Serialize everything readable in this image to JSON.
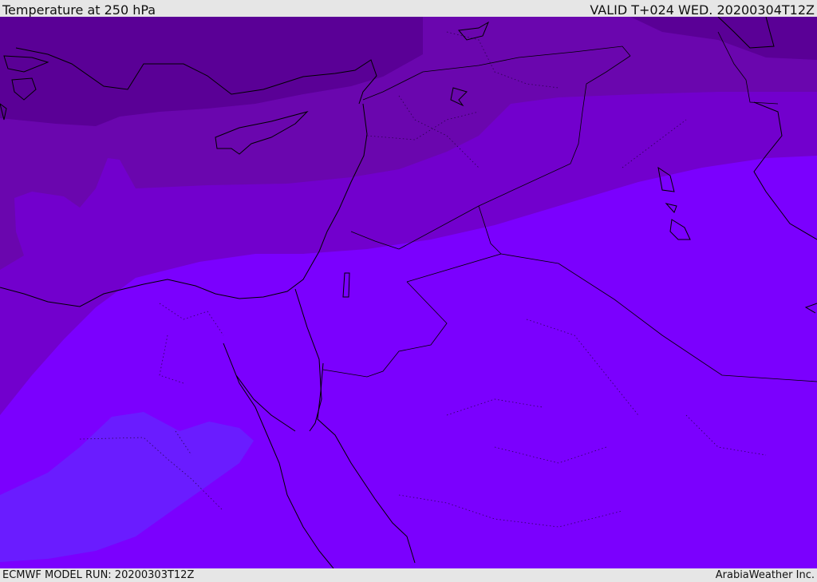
{
  "header": {
    "title": "Temperature at 250 hPa",
    "valid": "VALID T+024 WED. 20200304T12Z"
  },
  "footer": {
    "model_run": "ECMWF MODEL RUN: 20200303T12Z",
    "credit": "ArabiaWeather Inc."
  },
  "map": {
    "field": "temperature",
    "level": "250 hPa",
    "colors": {
      "band_coldest": "#5a0096",
      "band_cold": "#6a06ae",
      "band_mid": "#7200cd",
      "band_warm": "#7b00fe",
      "band_warmest": "#6a1cff",
      "coastline": "#000000",
      "border": "#000000"
    }
  }
}
